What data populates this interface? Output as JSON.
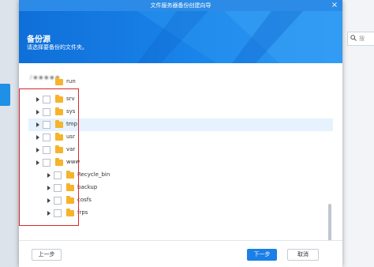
{
  "background": {
    "search_placeholder": "搜"
  },
  "dialog": {
    "title": "文件服务器备份创建向导",
    "close_glyph": "×",
    "banner_title": "备份源",
    "banner_subtitle": "请选择要备份的文件夹。",
    "path_partial": "run",
    "tree": {
      "folders": [
        {
          "name": "srv",
          "level": 0,
          "selected": false
        },
        {
          "name": "sys",
          "level": 0,
          "selected": false
        },
        {
          "name": "tmp",
          "level": 0,
          "selected": true
        },
        {
          "name": "usr",
          "level": 0,
          "selected": false
        },
        {
          "name": "var",
          "level": 0,
          "selected": false
        },
        {
          "name": "www",
          "level": 0,
          "selected": false,
          "expanded": true
        },
        {
          "name": "Recycle_bin",
          "level": 1,
          "selected": false
        },
        {
          "name": "backup",
          "level": 1,
          "selected": false
        },
        {
          "name": "cosfs",
          "level": 1,
          "selected": false
        },
        {
          "name": "frps",
          "level": 1,
          "selected": false
        }
      ]
    },
    "buttons": {
      "prev": "上一步",
      "next": "下一步",
      "cancel": "取消"
    },
    "colors": {
      "titlebar": "#2b8be6",
      "primary_button": "#1a7fe6",
      "highlight_box": "#d8262e",
      "folder": "#f6b32b"
    }
  }
}
